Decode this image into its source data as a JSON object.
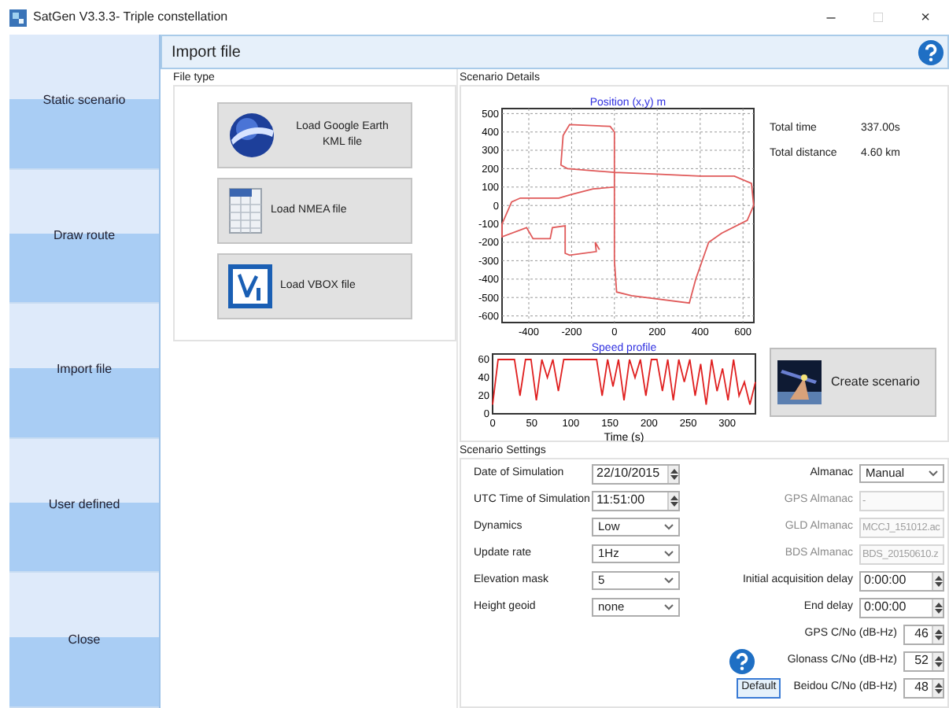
{
  "window": {
    "title": "SatGen V3.3.3- Triple constellation",
    "controls": [
      {
        "symbol": "–",
        "disabled": false
      },
      {
        "symbol": "□",
        "disabled": true
      },
      {
        "symbol": "×",
        "disabled": false
      }
    ]
  },
  "sidebar": {
    "items": [
      {
        "label": "Static scenario"
      },
      {
        "label": "Draw route"
      },
      {
        "label": "Import file"
      },
      {
        "label": "User defined"
      },
      {
        "label": "Close"
      }
    ]
  },
  "header": {
    "title": "Import file"
  },
  "file_type": {
    "title": "File type",
    "buttons": [
      {
        "label": "Load Google Earth KML file",
        "kind": "globe"
      },
      {
        "label": "Load NMEA file",
        "kind": "document"
      },
      {
        "label": "Load VBOX file",
        "kind": "vbox"
      }
    ]
  },
  "details": {
    "title": "Scenario Details",
    "position_chart": {
      "chart_data": {
        "type": "line",
        "title": "Position (x,y) m",
        "grid": true,
        "xlim": [
          -525,
          651
        ],
        "ylim": [
          -636,
          527
        ],
        "xticks": [
          -400,
          -200,
          0,
          200,
          400,
          600
        ],
        "yticks": [
          500,
          400,
          300,
          200,
          100,
          0,
          -100,
          -200,
          -300,
          -400,
          -500,
          -600
        ],
        "x": [
          -70,
          -90,
          -85,
          -210,
          -230,
          -230,
          -290,
          -300,
          -380,
          -410,
          -525,
          -525,
          -480,
          -440,
          -260,
          -200,
          -100,
          0,
          0,
          -20,
          -210,
          -240,
          -250,
          -220,
          0,
          200,
          400,
          560,
          640,
          650,
          620,
          500,
          440,
          380,
          350,
          80,
          10,
          0,
          0
        ],
        "series": [
          {
            "color": "#e05a5a",
            "values": [
              -240,
              -200,
              -250,
              -270,
              -260,
              -110,
              -120,
              -180,
              -180,
              -120,
              -170,
              -100,
              20,
              40,
              40,
              60,
              90,
              100,
              400,
              430,
              440,
              380,
              220,
              200,
              180,
              170,
              160,
              160,
              120,
              0,
              -80,
              -150,
              -200,
              -400,
              -530,
              -490,
              -470,
              -300,
              100
            ]
          }
        ]
      }
    },
    "speed_chart": {
      "chart_data": {
        "type": "line",
        "title": "Speed profile",
        "xlabel": "Time (s)",
        "xlim": [
          0,
          336
        ],
        "ylim": [
          0,
          66
        ],
        "xticks": [
          0,
          50,
          100,
          150,
          200,
          250,
          300
        ],
        "yticks": [
          0,
          20,
          40,
          60
        ],
        "x": [
          0,
          7,
          14,
          21,
          28,
          35,
          42,
          49,
          56,
          63,
          70,
          77,
          84,
          91,
          98,
          105,
          112,
          119,
          126,
          133,
          140,
          147,
          154,
          161,
          168,
          175,
          182,
          189,
          196,
          203,
          210,
          217,
          224,
          231,
          238,
          245,
          252,
          259,
          266,
          273,
          280,
          287,
          294,
          301,
          308,
          315,
          322,
          329,
          336
        ],
        "series": [
          {
            "color": "#e02020",
            "values": [
              10,
              60,
              60,
              60,
              60,
              20,
              60,
              60,
              15,
              60,
              40,
              60,
              25,
              60,
              60,
              60,
              60,
              60,
              60,
              60,
              20,
              60,
              30,
              60,
              15,
              60,
              40,
              60,
              20,
              60,
              60,
              25,
              60,
              15,
              60,
              35,
              60,
              20,
              55,
              10,
              60,
              25,
              50,
              15,
              60,
              20,
              35,
              10,
              35
            ]
          }
        ]
      }
    },
    "stats": [
      {
        "label": "Total time",
        "value": "337.00s"
      },
      {
        "label": "Total distance",
        "value": "4.60 km"
      }
    ],
    "create_button": {
      "label": "Create scenario"
    }
  },
  "settings": {
    "title": "Scenario Settings",
    "left": [
      {
        "label": "Date of Simulation",
        "kind": "spinner",
        "value": "22/10/2015"
      },
      {
        "label": "UTC Time of Simulation",
        "kind": "spinner",
        "value": "11:51:00"
      },
      {
        "label": "Dynamics",
        "kind": "select",
        "value": "Low"
      },
      {
        "label": "Update rate",
        "kind": "select",
        "value": "1Hz"
      },
      {
        "label": "Elevation mask",
        "kind": "select",
        "value": "5"
      },
      {
        "label": "Height geoid",
        "kind": "select",
        "value": "none"
      }
    ],
    "right": [
      {
        "label": "Almanac",
        "kind": "select",
        "value": "Manual",
        "disabled": false
      },
      {
        "label": "GPS Almanac",
        "kind": "text",
        "value": "-",
        "disabled": true
      },
      {
        "label": "GLD Almanac",
        "kind": "text",
        "value": "MCCJ_151012.ac",
        "disabled": true
      },
      {
        "label": "BDS Almanac",
        "kind": "text",
        "value": "BDS_20150610.z",
        "disabled": true
      },
      {
        "label": "Initial acquisition delay",
        "kind": "spinner",
        "value": "0:00:00",
        "disabled": false
      },
      {
        "label": "End delay",
        "kind": "spinner",
        "value": "0:00:00",
        "disabled": false
      },
      {
        "label": "GPS C/No (dB-Hz)",
        "kind": "number",
        "value": "46",
        "disabled": false
      },
      {
        "label": "Glonass C/No (dB-Hz)",
        "kind": "number",
        "value": "52",
        "disabled": false
      },
      {
        "label": "Beidou C/No (dB-Hz)",
        "kind": "number",
        "value": "48",
        "disabled": false
      }
    ],
    "default_button": "Default"
  }
}
